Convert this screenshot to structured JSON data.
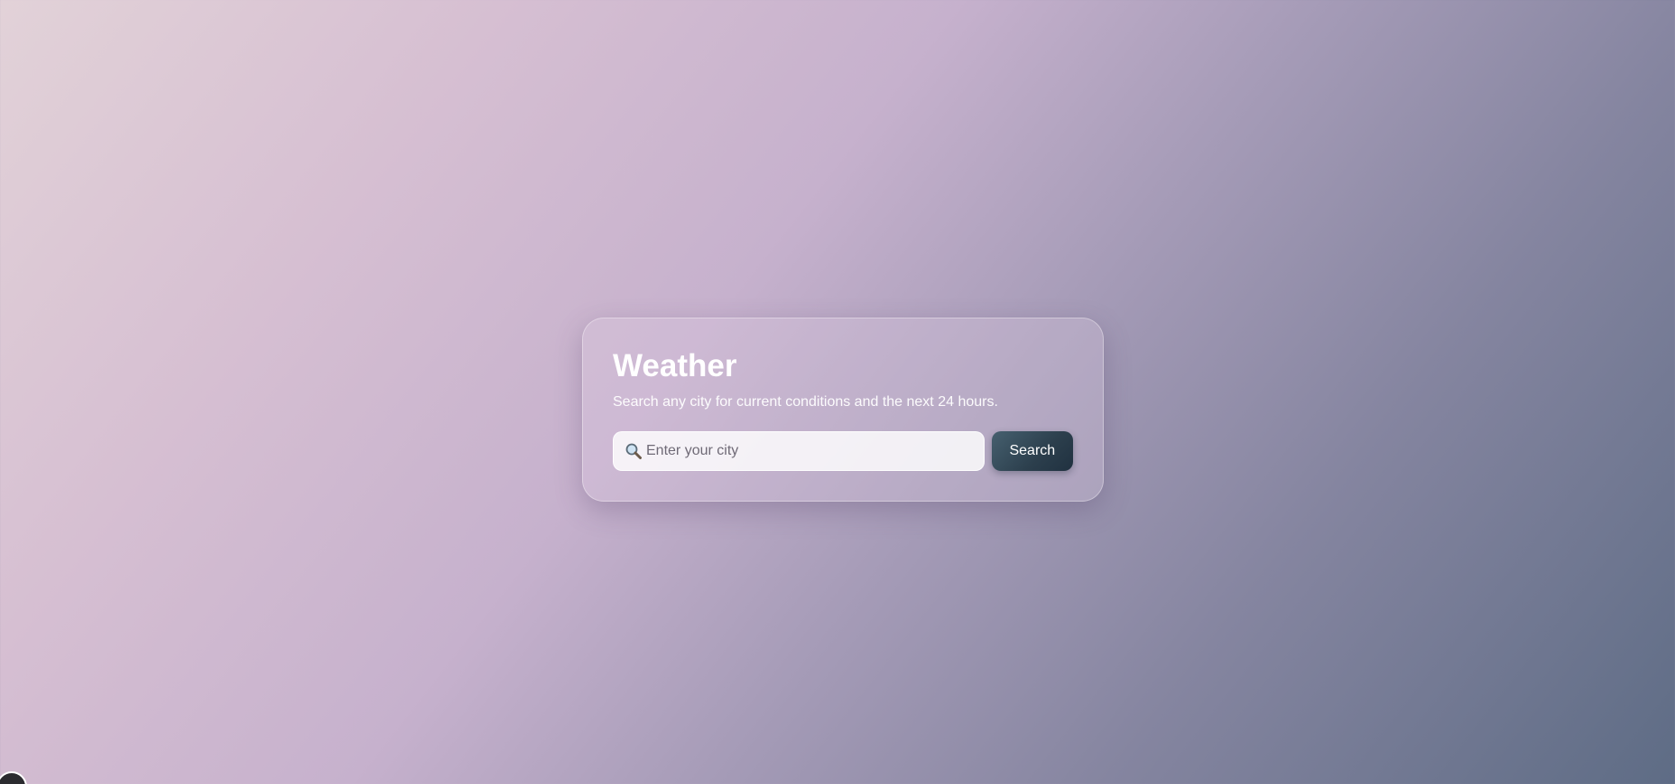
{
  "app": {
    "title": "Weather",
    "subtitle": "Search any city for current conditions and the next 24 hours."
  },
  "search": {
    "placeholder": "Enter your city",
    "value": "",
    "button_label": "Search",
    "icon": "magnifier-icon"
  },
  "colors": {
    "button": "#2c3f4d",
    "background_start": "#e2d2d8",
    "background_end": "#5e6c85"
  }
}
